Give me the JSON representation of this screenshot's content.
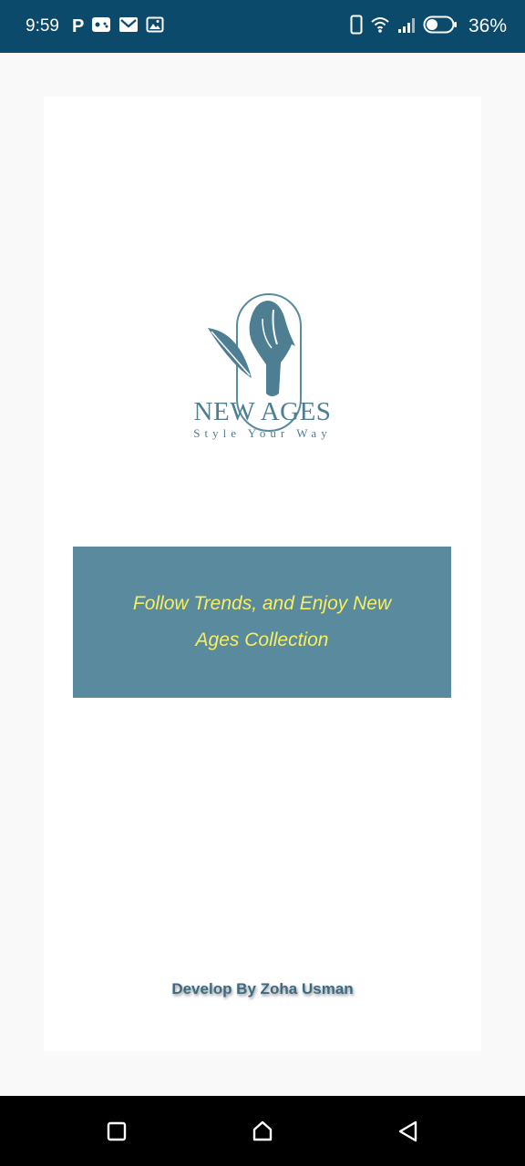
{
  "status_bar": {
    "time": "9:59",
    "p_label": "P",
    "battery": "36%",
    "icons": [
      "game-icon",
      "mail-icon",
      "image-icon",
      "phone-icon",
      "wifi-icon",
      "signal-icon",
      "battery-icon"
    ]
  },
  "brand": {
    "name": "NEW AGES",
    "tagline": "Style Your Way",
    "color": "#4d7e92"
  },
  "banner": {
    "text": "Follow Trends, and Enjoy New Ages Collection",
    "background": "#5a8a9e",
    "text_color": "#f6ef62"
  },
  "footer": {
    "credit": "Develop By Zoha Usman"
  },
  "nav": {
    "icons": [
      "recents-icon",
      "home-icon",
      "back-icon"
    ]
  }
}
